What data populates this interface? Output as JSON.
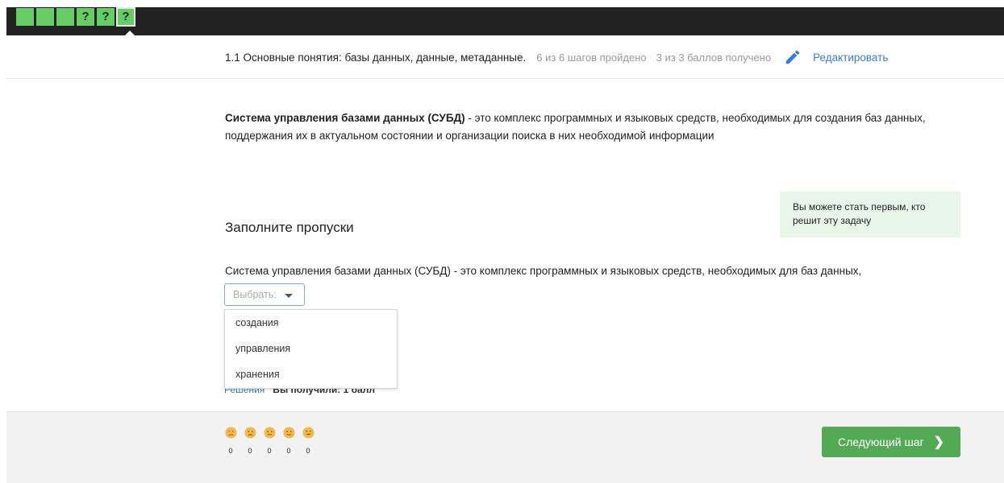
{
  "steps": [
    "",
    "",
    "",
    "?",
    "?",
    "?"
  ],
  "lesson": {
    "title": "1.1 Основные понятия: базы данных, данные, метаданные.",
    "steps_progress": "6 из 6 шагов пройдено",
    "points_progress": "3 из 3 баллов получено",
    "edit_label": "Редактировать"
  },
  "definition": {
    "term": "Система управления базами данных (СУБД)",
    "text": " - это комплекс программных и языковых средств, необходимых для создания баз данных, поддержания их в актуальном состоянии и организации поиска в них необходимой информации"
  },
  "hint": "Вы можете стать первым, кто решит эту задачу",
  "task": {
    "title": "Заполните пропуски",
    "text": "Система управления базами данных (СУБД) - это комплекс программных и языковых средств, необходимых для баз данных,",
    "select_placeholder": "Выбрать:",
    "options": [
      "создания",
      "управления",
      "хранения"
    ],
    "solutions_link": "Решения",
    "score_text": "Вы получили: 1 балл"
  },
  "reactions": [
    "0",
    "0",
    "0",
    "0",
    "0"
  ],
  "next_button": "Следующий шаг",
  "colors": {
    "accent": "#54a954",
    "step_done": "#66cc66",
    "link": "#3a7bd5"
  },
  "icons": {
    "edit": "pencil-icon",
    "next": "chevron-right-icon"
  }
}
